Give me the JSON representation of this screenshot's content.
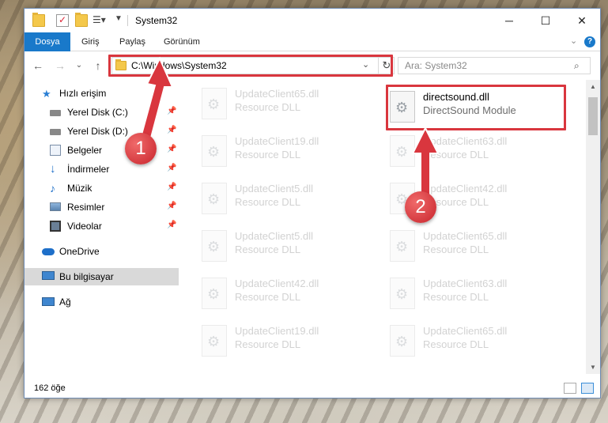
{
  "window": {
    "title": "System32",
    "controls": {
      "minimize": "─",
      "maximize": "☐",
      "close": "✕"
    }
  },
  "ribbon": {
    "file_tab": "Dosya",
    "tabs": [
      "Giriş",
      "Paylaş",
      "Görünüm"
    ],
    "help": "?"
  },
  "nav": {
    "back": "←",
    "forward": "→",
    "recent": "⌄",
    "up": "↑",
    "address": "C:\\Windows\\System32",
    "refresh": "↻",
    "search_placeholder": "Ara: System32",
    "search_icon": "⌕"
  },
  "sidebar": {
    "items": [
      {
        "label": "Hızlı erişim",
        "icon": "star-icon",
        "pinned": false
      },
      {
        "label": "Yerel Disk (C:)",
        "icon": "drive-icon",
        "pinned": true
      },
      {
        "label": "Yerel Disk (D:)",
        "icon": "drive-icon",
        "pinned": true
      },
      {
        "label": "Belgeler",
        "icon": "documents-icon",
        "pinned": true
      },
      {
        "label": "İndirmeler",
        "icon": "downloads-icon",
        "pinned": true
      },
      {
        "label": "Müzik",
        "icon": "music-icon",
        "pinned": true
      },
      {
        "label": "Resimler",
        "icon": "pictures-icon",
        "pinned": true
      },
      {
        "label": "Videolar",
        "icon": "videos-icon",
        "pinned": true
      },
      {
        "label": "OneDrive",
        "icon": "onedrive-icon",
        "pinned": false
      },
      {
        "label": "Bu bilgisayar",
        "icon": "computer-icon",
        "pinned": false,
        "selected": true
      },
      {
        "label": "Ağ",
        "icon": "network-icon",
        "pinned": false
      }
    ]
  },
  "files": {
    "highlighted": {
      "name": "directsound.dll",
      "desc": "DirectSound Module"
    },
    "left_column": [
      {
        "name": "UpdateClient65.dll",
        "desc": "Resource DLL"
      },
      {
        "name": "UpdateClient19.dll",
        "desc": "Resource DLL"
      },
      {
        "name": "UpdateClient5.dll",
        "desc": "Resource DLL"
      },
      {
        "name": "UpdateClient5.dll",
        "desc": "Resource DLL"
      },
      {
        "name": "UpdateClient42.dll",
        "desc": "Resource DLL"
      },
      {
        "name": "UpdateClient19.dll",
        "desc": "Resource DLL"
      }
    ],
    "right_column": [
      {
        "name": "UpdateClient63.dll",
        "desc": "Resource DLL"
      },
      {
        "name": "UpdateClient42.dll",
        "desc": "Resource DLL"
      },
      {
        "name": "UpdateClient65.dll",
        "desc": "Resource DLL"
      },
      {
        "name": "UpdateClient63.dll",
        "desc": "Resource DLL"
      },
      {
        "name": "UpdateClient65.dll",
        "desc": "Resource DLL"
      }
    ]
  },
  "status": {
    "count": "162 öğe"
  },
  "annotations": {
    "marker1": "1",
    "marker2": "2",
    "color": "#d9363e"
  }
}
